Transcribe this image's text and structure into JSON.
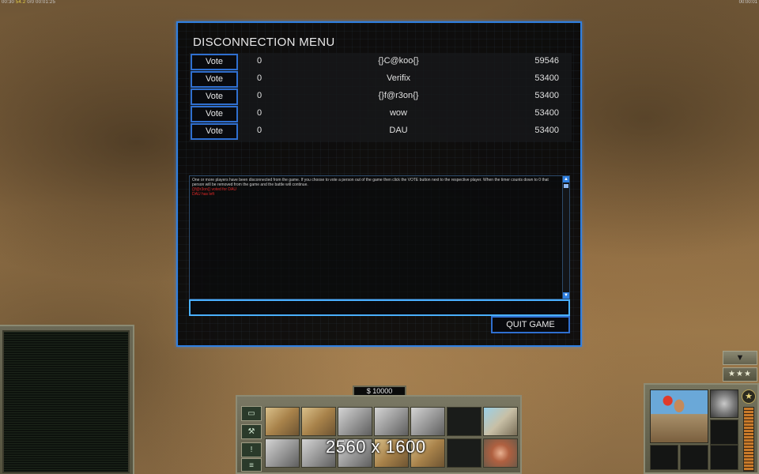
{
  "hud": {
    "top_left_info_a": "00:30 ",
    "top_left_info_fps": "54.2",
    "top_left_info_b": " 0/0  00:01:25",
    "top_right_info": "00:00:01",
    "money": "$ 10000",
    "resolution_overlay": "2560 x 1600"
  },
  "dialog": {
    "title": "DISCONNECTION MENU",
    "vote_label": "Vote",
    "players": [
      {
        "votes": "0",
        "name": "{}C@koo{}",
        "ping": "59546"
      },
      {
        "votes": "0",
        "name": "Verifix",
        "ping": "53400"
      },
      {
        "votes": "0",
        "name": "{}f@r3on{}",
        "ping": "53400"
      },
      {
        "votes": "0",
        "name": "wow",
        "ping": "53400"
      },
      {
        "votes": "0",
        "name": "DAU",
        "ping": "53400"
      }
    ],
    "chat_message": "One or more players have been disconnected from the game. If you choose to vote a person out of the game then click the VOTE button next to the respective player. When the timer counts down to 0 that person will be removed from the game and the battle will continue.",
    "chat_red_1": "{}f@r3on{} voted for DAU",
    "chat_red_2": "DAU has left",
    "quit_label": "QUIT GAME",
    "chat_input_value": ""
  },
  "command_bar": {
    "tab_icons": [
      "structures-tab-icon",
      "repair-tab-icon",
      "info-tab-icon",
      "options-tab-icon"
    ]
  },
  "right_panel": {
    "down_symbol": "▼",
    "stars": "★★★",
    "rank_symbol": "★"
  },
  "colors": {
    "dialog_border": "#2f7fe0",
    "chat_highlight": "#e02828",
    "hud_frame": "#76745e"
  }
}
